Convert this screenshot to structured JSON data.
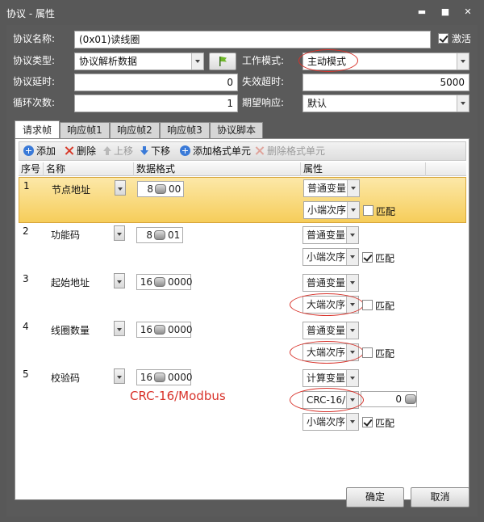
{
  "window": {
    "title": "协议 - 属性",
    "minimize_glyph": "▬",
    "maximize_glyph": "■",
    "close_glyph": "✕"
  },
  "form": {
    "name_label": "协议名称:",
    "name_value": "(0x01)读线圈",
    "activate_label": "激活",
    "activate_checked": true,
    "type_label": "协议类型:",
    "type_value": "协议解析数据",
    "work_mode_label": "工作模式:",
    "work_mode_value": "主动模式",
    "delay_label": "协议延时:",
    "delay_value": "0",
    "timeout_label": "失效超时:",
    "timeout_value": "5000",
    "loop_label": "循环次数:",
    "loop_value": "1",
    "period_label": "期望响应:",
    "period_value": "默认"
  },
  "tabs": [
    "请求帧",
    "响应帧1",
    "响应帧2",
    "响应帧3",
    "协议脚本"
  ],
  "toolbar": {
    "add": "添加",
    "delete": "删除",
    "move_up": "上移",
    "move_down": "下移",
    "add_format": "添加格式单元",
    "delete_format": "删除格式单元"
  },
  "grid": {
    "headers": [
      "序号",
      "名称",
      "数据格式",
      "属性"
    ],
    "rows": [
      {
        "index": "1",
        "name": "节点地址",
        "bits": "8",
        "hex": "00",
        "attr1": "普通变量",
        "attr2": "小端次序",
        "match_checked": false,
        "selected": true
      },
      {
        "index": "2",
        "name": "功能码",
        "bits": "8",
        "hex": "01",
        "attr1": "普通变量",
        "attr2": "小端次序",
        "match_checked": true,
        "selected": false
      },
      {
        "index": "3",
        "name": "起始地址",
        "bits": "16",
        "hex": "0000",
        "attr1": "普通变量",
        "attr2": "大端次序",
        "match_checked": false,
        "selected": false
      },
      {
        "index": "4",
        "name": "线圈数量",
        "bits": "16",
        "hex": "0000",
        "attr1": "普通变量",
        "attr2": "大端次序",
        "match_checked": false,
        "selected": false
      },
      {
        "index": "5",
        "name": "校验码",
        "bits": "16",
        "hex": "0000",
        "attr1": "计算变量",
        "attr2": "CRC-16/",
        "attr2_value": "0",
        "attr3": "小端次序",
        "match_checked": true,
        "selected": false
      }
    ],
    "match_label": "匹配"
  },
  "annotation_text": "CRC-16/Modbus",
  "buttons": {
    "ok": "确定",
    "cancel": "取消"
  },
  "colors": {
    "annotation": "#d8322a",
    "selected_row": "#f6cd5a",
    "window_bg": "#5a5a5a"
  }
}
